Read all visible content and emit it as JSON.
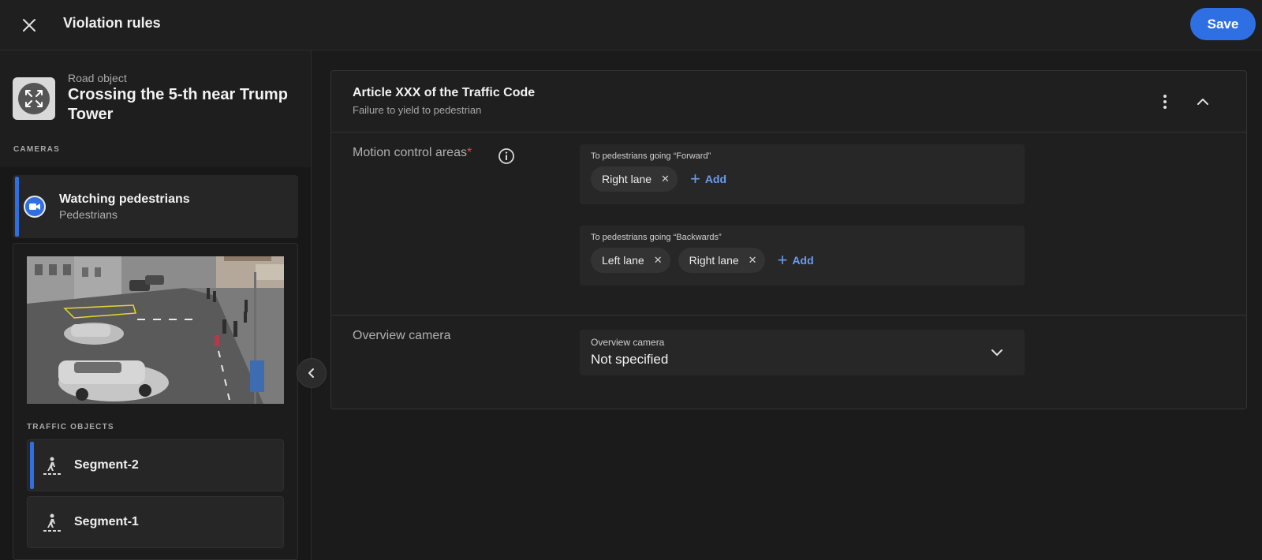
{
  "header": {
    "title": "Violation rules",
    "save_label": "Save"
  },
  "sidebar": {
    "road_object_label": "Road object",
    "road_object_name": "Crossing the 5-th near Trump Tower",
    "cameras_label": "CAMERAS",
    "camera": {
      "name": "Watching pedestrians",
      "subtitle": "Pedestrians"
    },
    "traffic_objects_label": "TRAFFIC OBJECTS",
    "segments": [
      {
        "label": "Segment-2",
        "selected": true
      },
      {
        "label": "Segment-1",
        "selected": false
      }
    ]
  },
  "rule": {
    "title": "Article XXX of the Traffic Code",
    "subtitle": "Failure to yield to pedestrian",
    "motion_label": "Motion control areas",
    "required_mark": "*",
    "forward": {
      "title": "To pedestrians going “Forward”",
      "chips": [
        "Right lane"
      ],
      "add_label": "Add"
    },
    "backward": {
      "title": "To pedestrians going “Backwards”",
      "chips": [
        "Left lane",
        "Right lane"
      ],
      "add_label": "Add"
    },
    "overview_label": "Overview camera",
    "overview_select": {
      "label": "Overview camera",
      "value": "Not specified"
    }
  },
  "colors": {
    "accent": "#2f6fe4",
    "link": "#6b9cf2",
    "required": "#e04848"
  },
  "icons": {
    "close": "close-icon",
    "road_object": "expand-arrows-icon",
    "camera": "video-camera-icon",
    "segment": "pedestrian-crossing-icon",
    "info": "info-icon",
    "more": "more-vertical-icon",
    "collapse": "chevron-up-icon",
    "sidebar_toggle": "chevron-left-icon",
    "select": "chevron-down-icon",
    "add": "plus-icon"
  }
}
